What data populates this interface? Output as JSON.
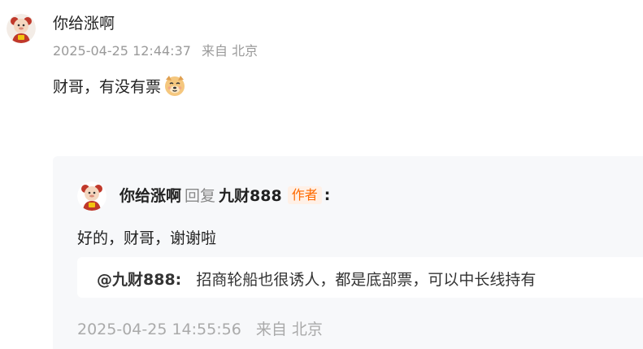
{
  "comment": {
    "username": "你给涨啊",
    "timestamp": "2025-04-25 12:44:37",
    "source": "来自 北京",
    "text": "财哥，有没有票",
    "emoji": "dog-face-icon"
  },
  "reply": {
    "username": "你给涨啊",
    "reply_word": "回复",
    "target_user": "九财888",
    "author_badge": "作者",
    "colon": ":",
    "text": "好的，财哥，谢谢啦",
    "quote": {
      "user": "@九财888:",
      "text": "招商轮船也很诱人，都是底部票，可以中长线持有"
    },
    "timestamp": "2025-04-25 14:55:56",
    "source": "来自 北京"
  },
  "colors": {
    "badge_text": "#ff6a00",
    "badge_bg": "#fff0e6",
    "reply_bg": "#f7f8fa",
    "meta": "#9a9a9a"
  }
}
